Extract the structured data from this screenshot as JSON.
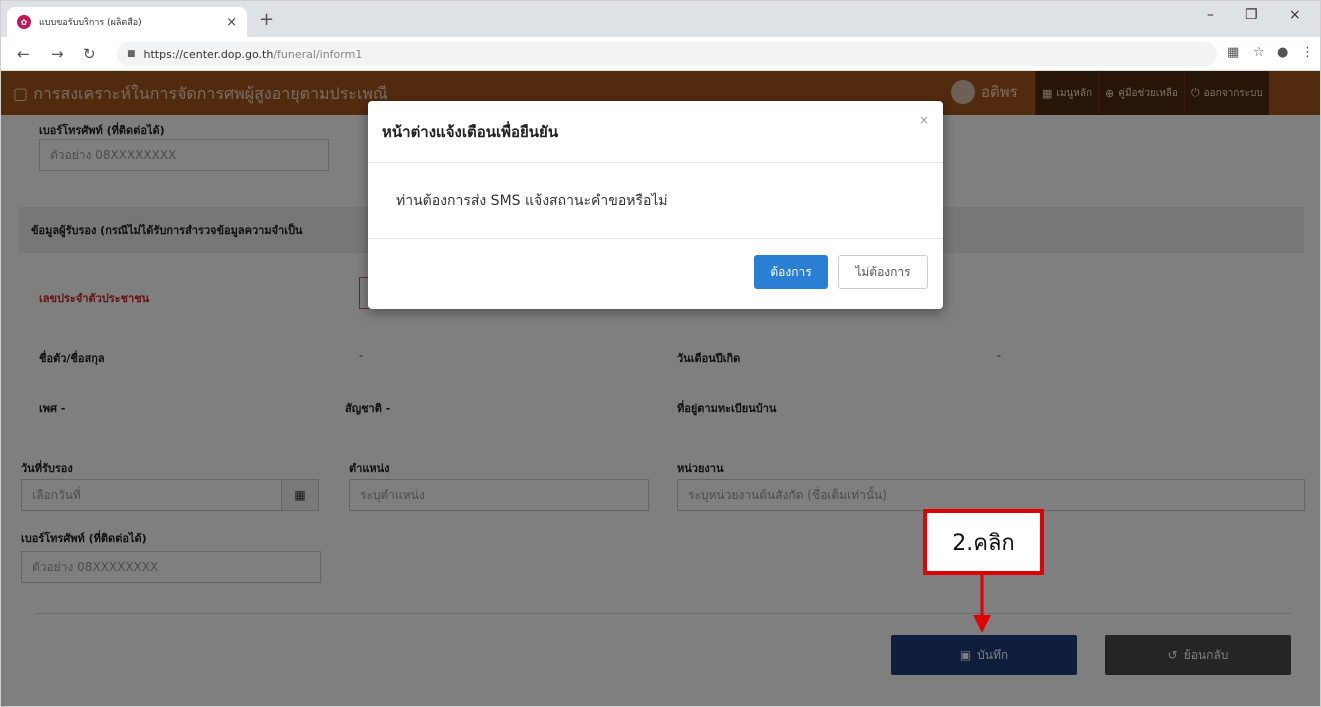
{
  "browser": {
    "tab_title": "แบบขอรับบริการ (ผลิตสือ)",
    "tab_close": "×",
    "new_tab": "+",
    "url_host": "https://center.dop.go.th",
    "url_path": "/funeral/inform1",
    "minimize": "–",
    "maximize": "❐",
    "close": "×"
  },
  "header": {
    "title": "การสงเคราะห์ในการจัดการศพผู้สูงอายุตามประเพณี",
    "user_name": "อติพร",
    "menu": [
      {
        "label": "เมนูหลัก",
        "icon": "grid-icon"
      },
      {
        "label": "คู่มือช่วยเหลือ",
        "icon": "help-icon"
      },
      {
        "label": "ออกจากระบบ",
        "icon": "power-icon"
      }
    ]
  },
  "form": {
    "top_phone_label": "เบอร์โทรศัพท์ (ที่ติดต่อได้)",
    "top_phone_placeholder": "ตัวอย่าง 08XXXXXXXX",
    "guarantor_section": "ข้อมูลผู้รับรอง (กรณีไม่ได้รับการสำรวจข้อมูลความจำเป็น",
    "id_label": "เลขประจำตัวประชาชน",
    "name_label": "ชื่อตัว/ชื่อสกุล",
    "name_value": "-",
    "dob_label": "วันเดือนปีเกิด",
    "dob_value": "-",
    "gender_label": "เพศ -",
    "nationality_label": "สัญชาติ -",
    "address_label": "ที่อยู่ตามทะเบียนบ้าน",
    "cert_date_label": "วันที่รับรอง",
    "cert_date_placeholder": "เลือกวันที่",
    "position_label": "ตำแหน่ง",
    "position_placeholder": "ระบุตำแหน่ง",
    "agency_label": "หน่วยงาน",
    "agency_placeholder": "ระบุหน่วยงานต้นสังกัด (ชื่อเต็มเท่านั้น)",
    "phone_label": "เบอร์โทรศัพท์ (ที่ติดต่อได้)",
    "phone_placeholder": "ตัวอย่าง 08XXXXXXXX",
    "save_label": "บันทึก",
    "back_label": "ย้อนกลับ"
  },
  "modal": {
    "title": "หน้าต่างแจ้งเตือนเพื่อยืนยัน",
    "message": "ท่านต้องการส่ง SMS แจ้งสถานะคำขอหรือไม่",
    "yes_label": "ต้องการ",
    "no_label": "ไม่ต้องการ",
    "close": "×"
  },
  "annotation": {
    "text": "2.คลิก",
    "color": "#e00000"
  }
}
